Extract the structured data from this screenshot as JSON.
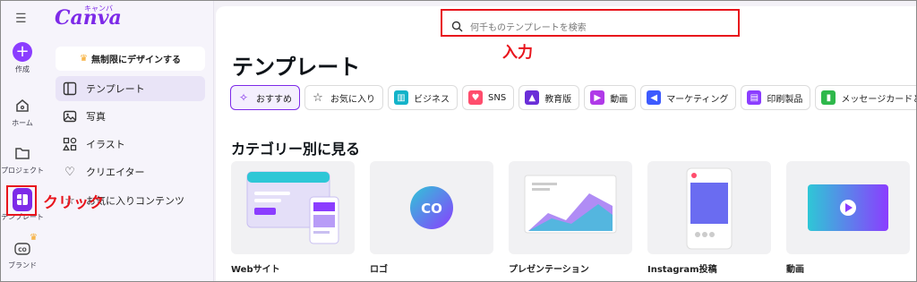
{
  "rail": {
    "items": [
      {
        "label": "作成",
        "icon": "plus-icon"
      },
      {
        "label": "ホーム",
        "icon": "home-icon"
      },
      {
        "label": "プロジェクト",
        "icon": "folder-icon"
      },
      {
        "label": "テンプレート",
        "icon": "template-icon"
      },
      {
        "label": "ブランド",
        "icon": "brand-icon"
      }
    ]
  },
  "panel": {
    "logo": "Canva",
    "logo_sub": "キャンバ",
    "pro_button": "無制限にデザインする",
    "nav": [
      {
        "label": "テンプレート",
        "icon": "template-icon"
      },
      {
        "label": "写真",
        "icon": "photo-icon"
      },
      {
        "label": "イラスト",
        "icon": "shapes-icon"
      },
      {
        "label": "クリエイター",
        "icon": "heart-icon"
      },
      {
        "label": "お気に入りコンテンツ",
        "icon": "star-icon"
      }
    ]
  },
  "main": {
    "search_placeholder": "何千ものテンプレートを検索",
    "title": "テンプレート",
    "chips": [
      {
        "label": "おすすめ",
        "color": "#7d2ae8"
      },
      {
        "label": "お気に入り",
        "color": "#333333"
      },
      {
        "label": "ビジネス",
        "color": "#13b3c9"
      },
      {
        "label": "SNS",
        "color": "#ff4d6d"
      },
      {
        "label": "教育版",
        "color": "#6a2ed8"
      },
      {
        "label": "動画",
        "color": "#b03ae8"
      },
      {
        "label": "マーケティング",
        "color": "#3d5afe"
      },
      {
        "label": "印刷製品",
        "color": "#8b3dff"
      },
      {
        "label": "メッセージカードと招",
        "color": "#2eb84b"
      }
    ],
    "section_title": "カテゴリー別に見る",
    "cards": [
      {
        "label": "Webサイト"
      },
      {
        "label": "ロゴ",
        "logo_text": "CO"
      },
      {
        "label": "プレゼンテーション"
      },
      {
        "label": "Instagram投稿"
      },
      {
        "label": "動画"
      }
    ]
  },
  "annotations": {
    "click_label": "クリック",
    "input_label": "入力",
    "color": "#e8141c"
  }
}
